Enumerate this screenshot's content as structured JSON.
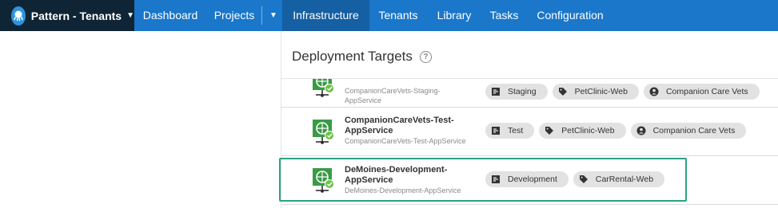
{
  "space": {
    "name": "Pattern - Tenants"
  },
  "nav": {
    "dashboard": "Dashboard",
    "projects": "Projects",
    "infrastructure": "Infrastructure",
    "tenants": "Tenants",
    "library": "Library",
    "tasks": "Tasks",
    "configuration": "Configuration"
  },
  "panel": {
    "title": "Deployment Targets"
  },
  "targets": [
    {
      "name": "CompanionCareVets-Staging-AppService",
      "subname": "CompanionCareVets-Staging-\nAppService",
      "chips": [
        {
          "icon": "environment-icon",
          "label": "Staging"
        },
        {
          "icon": "tag-icon",
          "label": "PetClinic-Web"
        },
        {
          "icon": "tenant-icon",
          "label": "Companion Care Vets"
        }
      ]
    },
    {
      "name": "CompanionCareVets-Test-AppService",
      "subname": "CompanionCareVets-Test-AppService",
      "chips": [
        {
          "icon": "environment-icon",
          "label": "Test"
        },
        {
          "icon": "tag-icon",
          "label": "PetClinic-Web"
        },
        {
          "icon": "tenant-icon",
          "label": "Companion Care Vets"
        }
      ]
    },
    {
      "name": "DeMoines-Development-AppService",
      "subname": "DeMoines-Development-AppService",
      "chips": [
        {
          "icon": "environment-icon",
          "label": "Development"
        },
        {
          "icon": "tag-icon",
          "label": "CarRental-Web"
        }
      ]
    }
  ],
  "colors": {
    "nav_bg": "#1a77ca",
    "nav_active": "#155fa3",
    "space_bg": "#0f2535",
    "highlight": "#2aa383",
    "target_icon": "#3a9a46"
  }
}
